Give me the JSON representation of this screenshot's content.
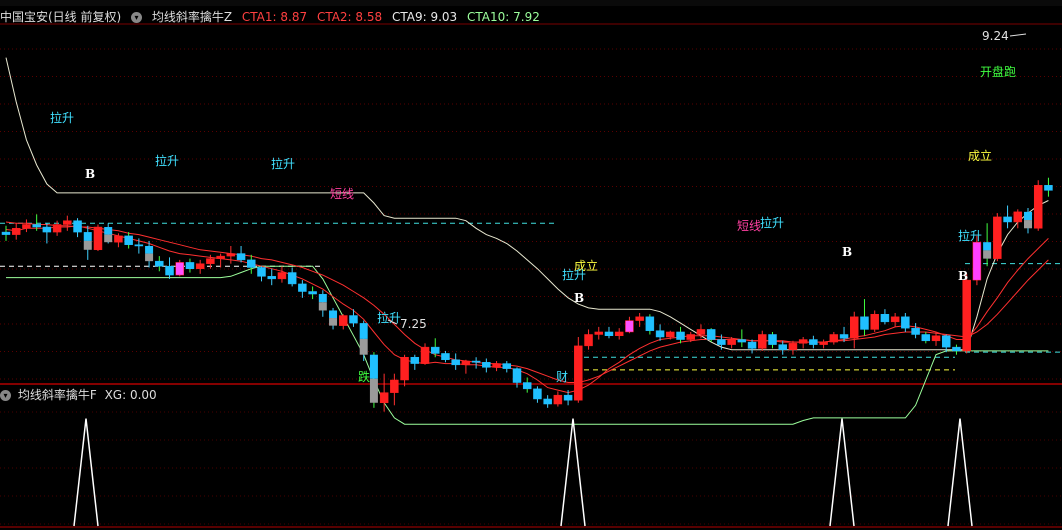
{
  "header": {
    "stock": "中国宝安(日线 前复权)",
    "indicator": "均线斜率擒牛Z",
    "items": [
      {
        "label": "CTA1: 8.87",
        "color": "#ff4040"
      },
      {
        "label": "CTA2: 8.58",
        "color": "#ff4040"
      },
      {
        "label": "CTA9: 9.03",
        "color": "#e8e8e8"
      },
      {
        "label": "CTA10: 7.92",
        "color": "#9cff9c"
      }
    ]
  },
  "subheader": {
    "indicator": "均线斜率擒牛F",
    "value": "XG: 0.00"
  },
  "chart_data": {
    "type": "candlestick",
    "price_range": [
      6.8,
      9.6
    ],
    "candles": [
      [
        7.97,
        8.02,
        7.9,
        7.95
      ],
      [
        7.95,
        8.04,
        7.91,
        8.0
      ],
      [
        8.0,
        8.07,
        7.97,
        8.03
      ],
      [
        8.03,
        8.11,
        7.98,
        8.01
      ],
      [
        8.01,
        8.04,
        7.88,
        7.97
      ],
      [
        7.97,
        8.06,
        7.94,
        8.03
      ],
      [
        8.03,
        8.1,
        7.98,
        8.06
      ],
      [
        8.06,
        8.08,
        7.93,
        7.97
      ],
      [
        7.97,
        8.02,
        7.75,
        7.83
      ],
      [
        7.83,
        8.03,
        7.82,
        8.01
      ],
      [
        8.01,
        8.04,
        7.88,
        7.89
      ],
      [
        7.89,
        7.96,
        7.85,
        7.94
      ],
      [
        7.94,
        7.97,
        7.84,
        7.87
      ],
      [
        7.87,
        7.92,
        7.8,
        7.86
      ],
      [
        7.86,
        7.9,
        7.69,
        7.74
      ],
      [
        7.74,
        7.78,
        7.66,
        7.7
      ],
      [
        7.7,
        7.77,
        7.6,
        7.63
      ],
      [
        7.63,
        7.75,
        7.62,
        7.73
      ],
      [
        7.73,
        7.76,
        7.65,
        7.68
      ],
      [
        7.68,
        7.75,
        7.64,
        7.72
      ],
      [
        7.72,
        7.79,
        7.68,
        7.76
      ],
      [
        7.76,
        7.8,
        7.69,
        7.78
      ],
      [
        7.78,
        7.86,
        7.72,
        7.8
      ],
      [
        7.8,
        7.86,
        7.73,
        7.75
      ],
      [
        7.75,
        7.79,
        7.64,
        7.69
      ],
      [
        7.69,
        7.7,
        7.58,
        7.62
      ],
      [
        7.62,
        7.68,
        7.55,
        7.6
      ],
      [
        7.6,
        7.7,
        7.57,
        7.65
      ],
      [
        7.65,
        7.69,
        7.54,
        7.56
      ],
      [
        7.56,
        7.59,
        7.45,
        7.5
      ],
      [
        7.5,
        7.54,
        7.44,
        7.48
      ],
      [
        7.48,
        7.51,
        7.3,
        7.35
      ],
      [
        7.35,
        7.37,
        7.2,
        7.23
      ],
      [
        7.23,
        7.32,
        7.2,
        7.31
      ],
      [
        7.31,
        7.36,
        7.22,
        7.25
      ],
      [
        7.25,
        7.27,
        6.95,
        7.0
      ],
      [
        7.0,
        7.02,
        6.58,
        6.62
      ],
      [
        6.62,
        6.85,
        6.55,
        6.7
      ],
      [
        6.7,
        6.85,
        6.6,
        6.8
      ],
      [
        6.8,
        7.0,
        6.75,
        6.98
      ],
      [
        6.98,
        7.0,
        6.88,
        6.93
      ],
      [
        6.93,
        7.09,
        6.92,
        7.06
      ],
      [
        7.06,
        7.13,
        6.98,
        7.01
      ],
      [
        7.01,
        7.03,
        6.94,
        6.96
      ],
      [
        6.96,
        7.01,
        6.88,
        6.92
      ],
      [
        6.92,
        6.96,
        6.85,
        6.95
      ],
      [
        6.95,
        6.98,
        6.89,
        6.94
      ],
      [
        6.94,
        6.97,
        6.86,
        6.9
      ],
      [
        6.9,
        6.95,
        6.87,
        6.93
      ],
      [
        6.93,
        6.95,
        6.86,
        6.89
      ],
      [
        6.89,
        6.9,
        6.74,
        6.78
      ],
      [
        6.78,
        6.82,
        6.7,
        6.73
      ],
      [
        6.73,
        6.75,
        6.62,
        6.65
      ],
      [
        6.65,
        6.68,
        6.58,
        6.61
      ],
      [
        6.61,
        6.71,
        6.59,
        6.68
      ],
      [
        6.68,
        6.72,
        6.6,
        6.64
      ],
      [
        6.64,
        7.14,
        6.62,
        7.07
      ],
      [
        7.07,
        7.2,
        7.04,
        7.16
      ],
      [
        7.16,
        7.22,
        7.12,
        7.18
      ],
      [
        7.18,
        7.22,
        7.13,
        7.15
      ],
      [
        7.15,
        7.21,
        7.12,
        7.18
      ],
      [
        7.18,
        7.3,
        7.17,
        7.27
      ],
      [
        7.27,
        7.33,
        7.22,
        7.3
      ],
      [
        7.3,
        7.32,
        7.16,
        7.19
      ],
      [
        7.19,
        7.24,
        7.11,
        7.14
      ],
      [
        7.14,
        7.19,
        7.12,
        7.18
      ],
      [
        7.18,
        7.22,
        7.09,
        7.12
      ],
      [
        7.12,
        7.18,
        7.1,
        7.16
      ],
      [
        7.16,
        7.24,
        7.13,
        7.2
      ],
      [
        7.2,
        7.21,
        7.1,
        7.12
      ],
      [
        7.12,
        7.16,
        7.04,
        7.08
      ],
      [
        7.08,
        7.14,
        7.05,
        7.12
      ],
      [
        7.12,
        7.2,
        7.06,
        7.1
      ],
      [
        7.1,
        7.12,
        7.01,
        7.05
      ],
      [
        7.05,
        7.19,
        7.03,
        7.16
      ],
      [
        7.16,
        7.18,
        7.05,
        7.08
      ],
      [
        7.08,
        7.11,
        7.0,
        7.04
      ],
      [
        7.04,
        7.11,
        7.0,
        7.09
      ],
      [
        7.09,
        7.14,
        7.05,
        7.12
      ],
      [
        7.12,
        7.15,
        7.05,
        7.08
      ],
      [
        7.08,
        7.12,
        7.05,
        7.1
      ],
      [
        7.1,
        7.18,
        7.08,
        7.16
      ],
      [
        7.16,
        7.22,
        7.1,
        7.13
      ],
      [
        7.13,
        7.34,
        7.05,
        7.3
      ],
      [
        7.3,
        7.44,
        7.15,
        7.2
      ],
      [
        7.2,
        7.35,
        7.18,
        7.32
      ],
      [
        7.32,
        7.36,
        7.24,
        7.26
      ],
      [
        7.26,
        7.33,
        7.22,
        7.3
      ],
      [
        7.3,
        7.33,
        7.18,
        7.21
      ],
      [
        7.21,
        7.25,
        7.13,
        7.16
      ],
      [
        7.16,
        7.18,
        7.09,
        7.11
      ],
      [
        7.11,
        7.18,
        7.07,
        7.15
      ],
      [
        7.15,
        7.16,
        7.02,
        7.06
      ],
      [
        7.06,
        7.08,
        7.0,
        7.03
      ],
      [
        7.03,
        7.64,
        7.01,
        7.59
      ],
      [
        7.59,
        7.94,
        7.55,
        7.89
      ],
      [
        7.89,
        8.04,
        7.7,
        7.76
      ],
      [
        7.76,
        8.12,
        7.74,
        8.09
      ],
      [
        8.09,
        8.18,
        8.0,
        8.05
      ],
      [
        8.05,
        8.15,
        8.0,
        8.13
      ],
      [
        8.13,
        8.16,
        7.96,
        8.0
      ],
      [
        8.0,
        8.38,
        7.98,
        8.34
      ],
      [
        8.34,
        8.4,
        8.25,
        8.3
      ]
    ],
    "ma_red_1": [
      7.99,
      7.98,
      8.0,
      8.0,
      8.0,
      8.01,
      8.01,
      8.02,
      8.0,
      7.98,
      7.96,
      7.94,
      7.92,
      7.9,
      7.88,
      7.85,
      7.82,
      7.8,
      7.79,
      7.78,
      7.77,
      7.76,
      7.75,
      7.74,
      7.72,
      7.7,
      7.68,
      7.66,
      7.63,
      7.6,
      7.56,
      7.52,
      7.46,
      7.4,
      7.35,
      7.28,
      7.18,
      7.08,
      7.0,
      6.96,
      6.94,
      6.93,
      6.94,
      6.93,
      6.93,
      6.92,
      6.92,
      6.91,
      6.9,
      6.9,
      6.88,
      6.85,
      6.8,
      6.74,
      6.72,
      6.7,
      6.72,
      6.76,
      6.82,
      6.89,
      6.94,
      7.0,
      7.05,
      7.09,
      7.12,
      7.13,
      7.14,
      7.15,
      7.15,
      7.15,
      7.14,
      7.13,
      7.12,
      7.11,
      7.11,
      7.11,
      7.1,
      7.1,
      7.1,
      7.1,
      7.1,
      7.11,
      7.12,
      7.14,
      7.15,
      7.17,
      7.19,
      7.22,
      7.23,
      7.22,
      7.2,
      7.18,
      7.15,
      7.12,
      7.12,
      7.22,
      7.34,
      7.45,
      7.57,
      7.67,
      7.76,
      7.84,
      7.92
    ],
    "ma_red_2": [
      8.05,
      8.04,
      8.04,
      8.03,
      8.03,
      8.02,
      8.02,
      8.01,
      8.01,
      8.0,
      7.99,
      7.98,
      7.96,
      7.95,
      7.93,
      7.91,
      7.89,
      7.87,
      7.85,
      7.83,
      7.82,
      7.81,
      7.8,
      7.79,
      7.78,
      7.76,
      7.75,
      7.73,
      7.71,
      7.69,
      7.66,
      7.63,
      7.59,
      7.55,
      7.5,
      7.45,
      7.39,
      7.32,
      7.24,
      7.16,
      7.09,
      7.04,
      7.0,
      6.98,
      6.96,
      6.95,
      6.94,
      6.93,
      6.93,
      6.92,
      6.91,
      6.89,
      6.86,
      6.83,
      6.8,
      6.78,
      6.78,
      6.8,
      6.83,
      6.87,
      6.91,
      6.95,
      6.99,
      7.03,
      7.06,
      7.08,
      7.1,
      7.11,
      7.12,
      7.12,
      7.12,
      7.12,
      7.12,
      7.11,
      7.11,
      7.11,
      7.11,
      7.1,
      7.1,
      7.1,
      7.1,
      7.11,
      7.11,
      7.12,
      7.13,
      7.14,
      7.16,
      7.17,
      7.18,
      7.18,
      7.18,
      7.17,
      7.16,
      7.15,
      7.14,
      7.18,
      7.24,
      7.32,
      7.41,
      7.5,
      7.59,
      7.67,
      7.75
    ],
    "ma_white": [
      9.35,
      9.0,
      8.7,
      8.5,
      8.35,
      8.28,
      8.28,
      8.28,
      8.28,
      8.28,
      8.28,
      8.28,
      8.28,
      8.28,
      8.28,
      8.28,
      8.28,
      8.28,
      8.28,
      8.28,
      8.28,
      8.28,
      8.28,
      8.28,
      8.28,
      8.28,
      8.28,
      8.28,
      8.28,
      8.28,
      8.28,
      8.28,
      8.28,
      8.28,
      8.28,
      8.28,
      8.2,
      8.1,
      8.08,
      8.08,
      8.08,
      8.08,
      8.08,
      8.08,
      8.08,
      8.06,
      8.0,
      7.95,
      7.92,
      7.88,
      7.82,
      7.75,
      7.68,
      7.6,
      7.52,
      7.45,
      7.4,
      7.37,
      7.36,
      7.36,
      7.36,
      7.36,
      7.36,
      7.36,
      7.34,
      7.3,
      7.25,
      7.2,
      7.15,
      7.1,
      7.06,
      7.04,
      7.04,
      7.04,
      7.04,
      7.04,
      7.04,
      7.04,
      7.04,
      7.04,
      7.04,
      7.04,
      7.04,
      7.04,
      7.04,
      7.04,
      7.04,
      7.04,
      7.04,
      7.04,
      7.04,
      7.04,
      7.04,
      7.04,
      7.04,
      7.3,
      7.6,
      7.8,
      7.95,
      8.05,
      8.12,
      8.18,
      8.22
    ],
    "ma_green": [
      7.61,
      7.61,
      7.61,
      7.61,
      7.61,
      7.61,
      7.61,
      7.61,
      7.61,
      7.61,
      7.61,
      7.61,
      7.61,
      7.61,
      7.61,
      7.61,
      7.61,
      7.61,
      7.61,
      7.61,
      7.61,
      7.61,
      7.62,
      7.65,
      7.68,
      7.7,
      7.7,
      7.7,
      7.7,
      7.7,
      7.7,
      7.6,
      7.45,
      7.3,
      7.15,
      7.0,
      6.8,
      6.62,
      6.5,
      6.45,
      6.45,
      6.45,
      6.45,
      6.45,
      6.45,
      6.45,
      6.45,
      6.45,
      6.45,
      6.45,
      6.45,
      6.45,
      6.45,
      6.45,
      6.45,
      6.45,
      6.45,
      6.45,
      6.45,
      6.45,
      6.45,
      6.45,
      6.45,
      6.45,
      6.45,
      6.45,
      6.45,
      6.45,
      6.45,
      6.45,
      6.45,
      6.45,
      6.45,
      6.45,
      6.45,
      6.45,
      6.45,
      6.45,
      6.48,
      6.5,
      6.5,
      6.5,
      6.5,
      6.5,
      6.5,
      6.5,
      6.5,
      6.5,
      6.5,
      6.6,
      6.8,
      7.0,
      7.03,
      7.03,
      7.03,
      7.03,
      7.03,
      7.03,
      7.03,
      7.03,
      7.03,
      7.03,
      7.03
    ],
    "dashed_levels": [
      {
        "price": 8.04,
        "color": "#40e0e0"
      },
      {
        "price": 7.7,
        "color": "#ffffff"
      },
      {
        "price": 6.98,
        "color": "#40e0e0"
      },
      {
        "price": 6.88,
        "color": "#ffff40"
      },
      {
        "price": 7.72,
        "color": "#40e0e0"
      },
      {
        "price": 7.02,
        "color": "#40e0e0"
      }
    ],
    "annotations": [
      {
        "text": "拉升",
        "color": "#40e0ff"
      },
      {
        "text": "拉升",
        "color": "#40e0ff"
      },
      {
        "text": "拉升",
        "color": "#40e0ff"
      },
      {
        "text": "短线",
        "color": "#ff40a0"
      },
      {
        "text": "拉升",
        "color": "#40e0ff"
      },
      {
        "text": "成立",
        "color": "#ffff40"
      },
      {
        "text": "拉升",
        "color": "#40e0ff"
      },
      {
        "text": "短线",
        "color": "#ff40a0"
      },
      {
        "text": "拉升",
        "color": "#40e0ff"
      },
      {
        "text": "成立",
        "color": "#ffff40"
      },
      {
        "text": "拉升",
        "color": "#40e0ff"
      },
      {
        "text": "开盘跑",
        "color": "#40ff40"
      },
      {
        "text": "B",
        "color": "#ffffff"
      },
      {
        "text": "B",
        "color": "#ffffff"
      },
      {
        "text": "B",
        "color": "#ffffff"
      },
      {
        "text": "B",
        "color": "#ffffff"
      },
      {
        "text": "9.24",
        "color": "#e0e0e0"
      },
      {
        "text": "7.25",
        "color": "#e0e0e0"
      },
      {
        "text": "跌",
        "color": "#40ff40"
      },
      {
        "text": "财",
        "color": "#40e0ff"
      }
    ],
    "xg_signals": [
      0,
      0,
      0,
      0
    ],
    "xg_ylim": [
      0,
      1
    ]
  }
}
